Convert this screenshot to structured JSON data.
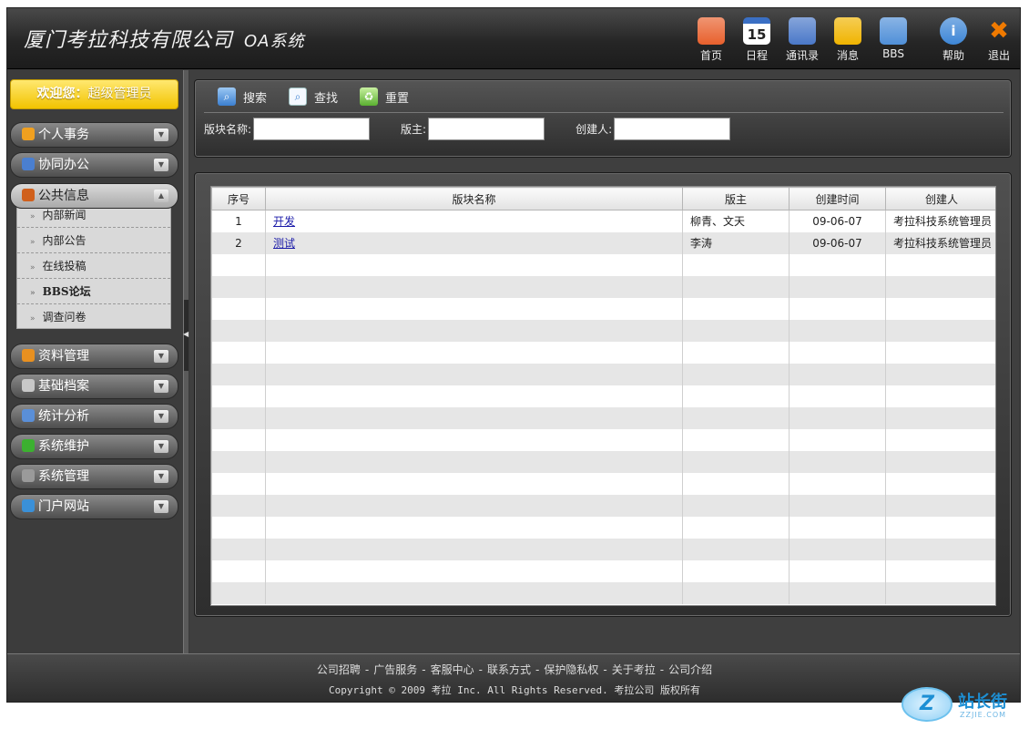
{
  "header": {
    "company": "厦门考拉科技有限公司",
    "system": "OA系统",
    "nav": [
      {
        "label": "首页",
        "icon": "home-icon",
        "color": "#e8602c"
      },
      {
        "label": "日程",
        "icon": "calendar-icon",
        "color": "#3a6fc4",
        "glyph": "15"
      },
      {
        "label": "通讯录",
        "icon": "address-book-icon",
        "color": "#4a78c8"
      },
      {
        "label": "消息",
        "icon": "message-icon",
        "color": "#f0b400"
      },
      {
        "label": "BBS",
        "icon": "bbs-icon",
        "color": "#4f8fd8"
      },
      {
        "label": "帮助",
        "icon": "help-icon",
        "color": "#3d86d6",
        "glyph": "i"
      },
      {
        "label": "退出",
        "icon": "exit-icon",
        "color": "#f07a00",
        "glyph": "✖"
      }
    ]
  },
  "sidebar": {
    "welcome_prefix": "欢迎您：",
    "welcome_user": "超级管理员",
    "menus": [
      {
        "label": "个人事务",
        "icon": "pencil-icon",
        "color": "#f0a020"
      },
      {
        "label": "协同办公",
        "icon": "pin-icon",
        "color": "#4a7fd0"
      },
      {
        "label": "公共信息",
        "icon": "briefcase-icon",
        "color": "#d0601c"
      },
      {
        "label": "资料管理",
        "icon": "tag-icon",
        "color": "#e89020"
      },
      {
        "label": "基础档案",
        "icon": "clipboard-icon",
        "color": "#c8c8c8"
      },
      {
        "label": "统计分析",
        "icon": "chart-icon",
        "color": "#5a8fd8"
      },
      {
        "label": "系统维护",
        "icon": "plus-icon",
        "color": "#3cb030"
      },
      {
        "label": "系统管理",
        "icon": "gear-icon",
        "color": "#9a9a9a"
      },
      {
        "label": "门户网站",
        "icon": "globe-icon",
        "color": "#3a90d8"
      }
    ],
    "submenu": [
      {
        "label": "内部新闻"
      },
      {
        "label": "内部公告"
      },
      {
        "label": "在线投稿"
      },
      {
        "label": "BBS论坛"
      },
      {
        "label": "调查问卷"
      }
    ]
  },
  "toolbar": {
    "search": "搜索",
    "find": "查找",
    "reset": "重置"
  },
  "filters": {
    "board_name_label": "版块名称:",
    "moderator_label": "版主:",
    "creator_label": "创建人:",
    "board_name_value": "",
    "moderator_value": "",
    "creator_value": ""
  },
  "table": {
    "columns": [
      "序号",
      "版块名称",
      "版主",
      "创建时间",
      "创建人"
    ],
    "rows": [
      {
        "no": "1",
        "name": "开发",
        "moderator": "柳青、文天",
        "created": "09-06-07",
        "creator": "考拉科技系统管理员"
      },
      {
        "no": "2",
        "name": "测试",
        "moderator": "李涛",
        "created": "09-06-07",
        "creator": "考拉科技系统管理员"
      }
    ]
  },
  "footer": {
    "links": [
      "公司招聘",
      "广告服务",
      "客服中心",
      "联系方式",
      "保护隐私权",
      "关于考拉",
      "公司介绍"
    ],
    "separator": "-",
    "copyright": "Copyright © 2009 考拉 Inc. All Rights Reserved. 考拉公司 版权所有"
  },
  "watermark": {
    "logo_text": "站长街",
    "url": "ZZJIE.COM"
  }
}
